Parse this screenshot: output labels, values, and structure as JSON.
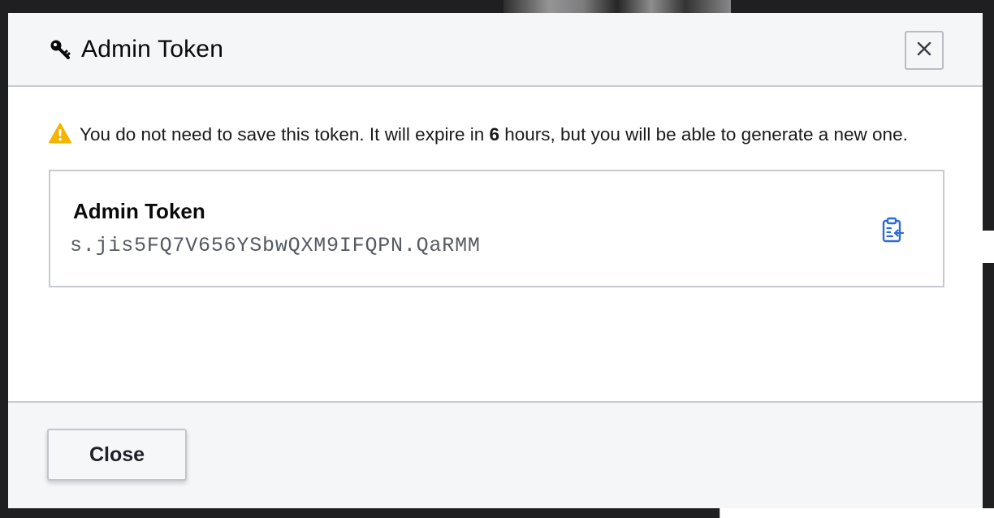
{
  "modal": {
    "title": "Admin Token",
    "title_icon": "key-icon",
    "close_icon": "close-icon"
  },
  "warning": {
    "icon": "warning-icon",
    "text_before": "You do not need to save this token. It will expire in ",
    "hours": "6",
    "text_after": " hours, but you will be able to generate a new one."
  },
  "token": {
    "label": "Admin Token",
    "value": "s.jis5FQ7V656YSbwQXM9IFQPN.QaRMM",
    "copy_icon": "clipboard-copy-icon"
  },
  "footer": {
    "close_label": "Close"
  },
  "colors": {
    "accent": "#2e6bd8",
    "warning": "#f4b400",
    "header_bg": "#f5f6f8",
    "border": "#c8cbd1"
  }
}
